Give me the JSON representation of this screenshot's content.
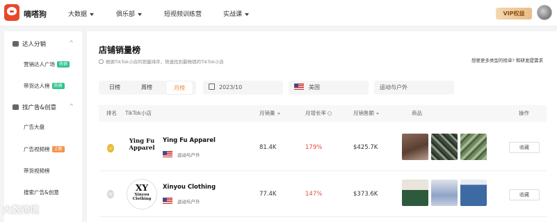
{
  "app": {
    "brand": "嘀嗒狗",
    "vip_label": "VIP权益"
  },
  "nav": [
    "大数据",
    "俱乐部",
    "短视频训练营",
    "实战课"
  ],
  "sidebar": {
    "groups": [
      {
        "label": "达人分销",
        "items": [
          {
            "label": "营销达人广场",
            "tag": "热销"
          },
          {
            "label": "带货达人榜",
            "tag": "热销"
          }
        ]
      },
      {
        "label": "找广告&创意",
        "items": [
          {
            "label": "广告大盘",
            "tag": ""
          },
          {
            "label": "广告视频榜",
            "tag": "上新"
          },
          {
            "label": "带货视频榜",
            "tag": ""
          },
          {
            "label": "搜索广告&创意",
            "tag": ""
          }
        ]
      }
    ]
  },
  "main": {
    "title": "店铺销量榜",
    "description": "根据TikTok小店的销量排序，快速找到最畅销的TikTok小店",
    "request_text": "想要更多类型的榜单?",
    "request_link": "和研发提需求",
    "tabs": [
      "日榜",
      "周榜",
      "月榜"
    ],
    "active_tab": "月榜",
    "date": "2023/10",
    "country": "美国",
    "category": "运动与户外"
  },
  "table": {
    "headers": {
      "rank": "排名",
      "shop": "TikTok小店",
      "sales": "月销量",
      "growth": "月增长率",
      "gmv": "月销售额",
      "products": "商品",
      "action": "操作"
    },
    "rows": [
      {
        "logo_line1": "Ying Fu",
        "logo_line2": "Apparel",
        "name": "Ying Fu Apparel",
        "category": "运动与户外",
        "sales": "81.4K",
        "growth": "179%",
        "gmv": "$425.7K",
        "action": "收藏"
      },
      {
        "logo_line1": "XY",
        "logo_line2": "Xinyou Clothing",
        "name": "Xinyou Clothing",
        "category": "运动与户外",
        "sales": "77.4K",
        "growth": "147%",
        "gmv": "$373.6K",
        "action": "收藏"
      }
    ]
  },
  "watermark": "大数跨境",
  "colors": {
    "accent": "#f08a3e",
    "growth": "#e04b3a",
    "vip_bg": "#e9be86"
  }
}
